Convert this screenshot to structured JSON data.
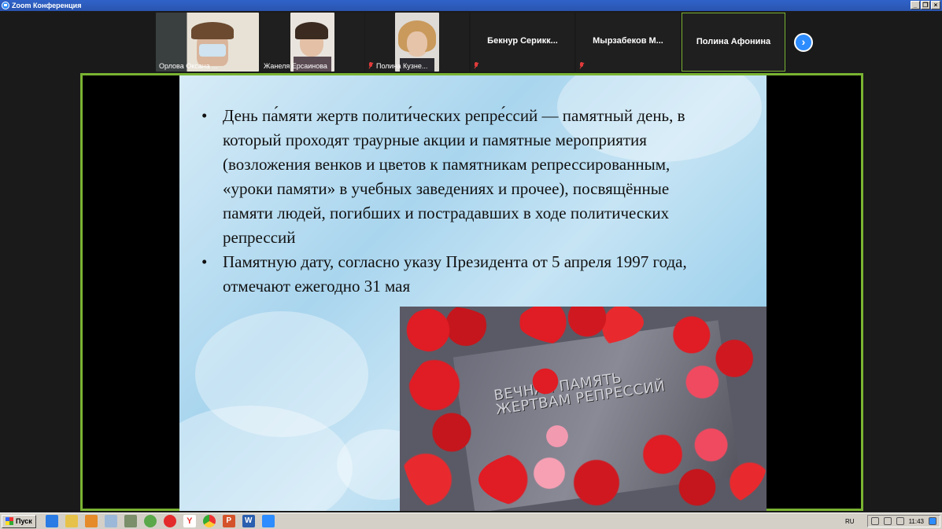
{
  "window": {
    "title": "Zoom Конференция"
  },
  "participants": [
    {
      "name": "Орлова Оксана ...",
      "muted": false,
      "video": true
    },
    {
      "name": "Жанеля Ерсаинова",
      "muted": false,
      "video": true
    },
    {
      "name": "Полина Кузне...",
      "muted": true,
      "video": true
    },
    {
      "name": "Бекнур Серикк...",
      "muted": true,
      "video": false
    },
    {
      "name": "Мырзабеков М...",
      "muted": true,
      "video": false
    },
    {
      "name": "Полина Афонина",
      "muted": false,
      "video": false,
      "active": true
    }
  ],
  "slide": {
    "bullets": [
      "День па́мяти жертв полити́ческих репре́ссий — памятный день, в который проходят траурные акции и памятные мероприятия (возложения венков и цветов к памятникам репрессированным, «уроки памяти» в учебных заведениях и прочее), посвящённые памяти людей, погибших и пострадавших в ходе политических репрессий",
      "Памятную дату, согласно указу Президента от 5 апреля 1997 года, отмечают ежегодно 31 мая"
    ],
    "photo_text_line1": "ВЕЧНАЯ ПАМЯТЬ",
    "photo_text_line2": "ЖЕРТВАМ РЕПРЕССИЙ"
  },
  "taskbar": {
    "start_label": "Пуск",
    "language": "RU",
    "clock": "11:43"
  },
  "colors": {
    "active_border": "#7ab332",
    "zoom_blue": "#2d8cff",
    "titlebar": "#2a55b0"
  }
}
